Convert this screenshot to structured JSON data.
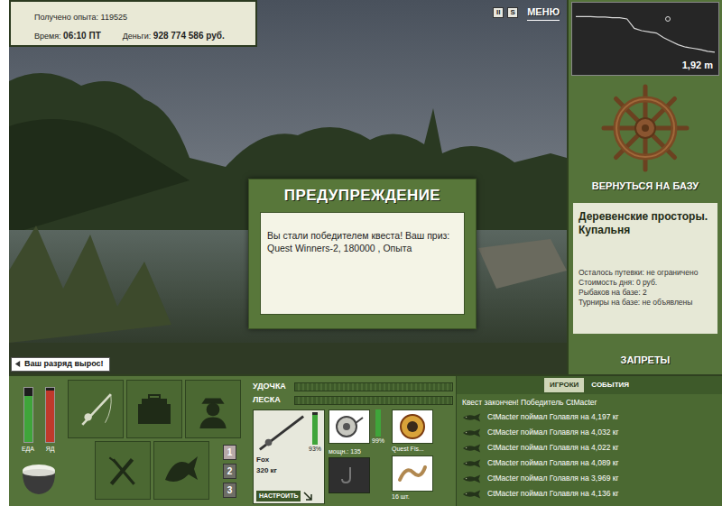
{
  "stats": {
    "experience_label": "Получено опыта:",
    "experience": "119525",
    "time_label": "Время:",
    "time": "06:10 ПТ",
    "money_label": "Деньги:",
    "money": "928 774 586 руб."
  },
  "top_controls": [
    "II",
    "S",
    "МЕНЮ"
  ],
  "depth": {
    "reading": "1,92 m",
    "values": [
      0.4,
      0.4,
      0.4,
      0.42,
      0.42,
      0.45,
      0.45,
      0.5,
      0.9,
      1.0,
      1.05,
      1.1,
      1.3,
      1.45,
      1.6,
      1.7,
      1.75,
      1.8,
      1.88,
      1.92
    ]
  },
  "return_button": "ВЕРНУТЬСЯ НА БАЗУ",
  "location": {
    "title": "Деревенские просторы. Купальня",
    "details": [
      "Осталось путевки: не ограничено",
      "Стоимость дня: 0 руб.",
      "Рыбаков на базе: 2",
      "Турниры на базе: не объявлены"
    ]
  },
  "restrictions_button": "ЗАПРЕТЫ",
  "dialog": {
    "title": "ПРЕДУПРЕЖДЕНИЕ",
    "message": "Вы стали победителем квеста! Ваш приз: Quest Winners-2, 180000 , Опыта"
  },
  "notification": "Ваш разряд вырос!",
  "meters": [
    {
      "label": "ЕДА",
      "level": 0.85,
      "color": "#3fa53a"
    },
    {
      "label": "ЯД",
      "level": 0.95,
      "color": "#c0392b"
    }
  ],
  "slots": [
    {
      "label": "1",
      "selected": true
    },
    {
      "label": "2",
      "selected": false
    },
    {
      "label": "3",
      "selected": false
    }
  ],
  "tension": [
    {
      "label": "УДОЧКА",
      "level": 0
    },
    {
      "label": "ЛЕСКА",
      "level": 0
    }
  ],
  "rod": {
    "condition": "93%",
    "level": 0.93,
    "name": "Fox",
    "capacity": "320 кг",
    "button": "НАСТРОИТЬ"
  },
  "reel": {
    "power": "мощн.: 135",
    "condition": "99%",
    "level": 0.99
  },
  "line": {
    "name": "Quest Fis..."
  },
  "bait": {
    "count": "16 шт."
  },
  "log_tabs": [
    {
      "label": "ИГРОКИ",
      "selected": true
    },
    {
      "label": "СОБЫТИЯ",
      "selected": false
    }
  ],
  "log": {
    "header": "Квест закончен! Победитель CtMacter",
    "entries": [
      "CtMacter поймал Голавля на 4,197 кг",
      "CtMacter поймал Голавля на 4,032 кг",
      "CtMacter поймал Голавля на 4,022 кг",
      "CtMacter поймал Голавля на 4,089 кг",
      "CtMacter поймал Голавля на 3,969 кг",
      "CtMacter поймал Голавля на 4,136 кг"
    ]
  }
}
